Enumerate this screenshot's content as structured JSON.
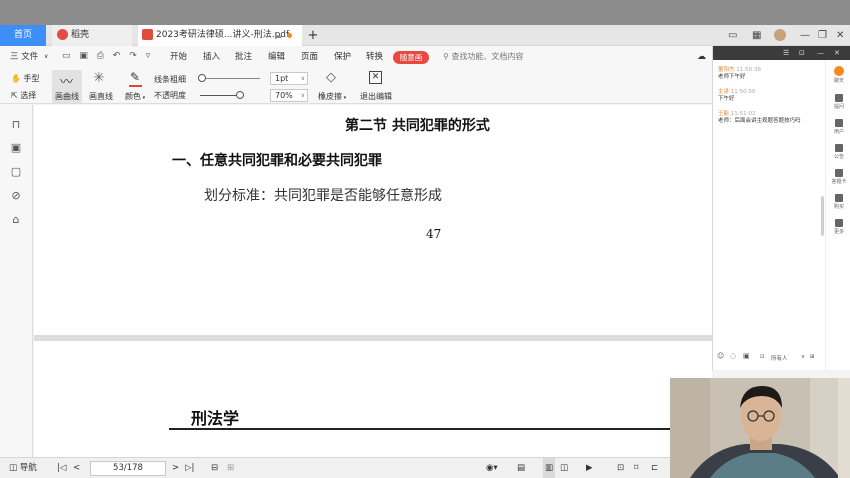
{
  "tabs": {
    "home": "首页",
    "daoke": "稻壳",
    "doc": "2023考研法律硕...讲义-刑法.pdf",
    "plus": "+"
  },
  "window_controls": [
    "▭",
    "▦",
    "—",
    "❐",
    "✕"
  ],
  "menu": {
    "file": "三 文件",
    "items": [
      "开始",
      "插入",
      "批注",
      "编辑",
      "页面",
      "保护",
      "转换"
    ],
    "badge": "随意画",
    "search_placeholder": "查找功能、文档内容"
  },
  "toolbar": {
    "hand": "手型",
    "select": "选择",
    "curve": "画曲线",
    "straight": "画直线",
    "color": "颜色",
    "thickness": "线条粗细",
    "opacity": "不透明度",
    "thickness_value": "1pt",
    "opacity_value": "70%",
    "eraser": "橡皮擦",
    "exit": "退出编辑"
  },
  "document": {
    "section_title": "第二节    共同犯罪的形式",
    "heading": "一、任意共同犯罪和必要共同犯罪",
    "body": "划分标准：共同犯罪是否能够任意形成",
    "page_number": "47",
    "page2_title": "刑法学"
  },
  "statusbar": {
    "nav": "导航",
    "page_indicator": "53/178"
  },
  "chat": {
    "header_icons": [
      "☰",
      "⊡",
      "—",
      "✕"
    ],
    "messages": [
      {
        "name": "董阳杰",
        "time": "11:50:38",
        "body": "老师下午好"
      },
      {
        "name": "主讲",
        "time": "11:50:50",
        "body": "下午好"
      },
      {
        "name": "王能",
        "time": "11:51:02",
        "body": "老师：后面会讲主观题答题技巧吗"
      }
    ],
    "side": [
      "聊天",
      "提问",
      "用户",
      "公告",
      "答题卡",
      "购买",
      "更多"
    ],
    "input_hint": "所有人"
  },
  "colors": {
    "accent": "#3e8ef7",
    "badge": "#e8493f",
    "chat_name": "#e68a3c"
  }
}
